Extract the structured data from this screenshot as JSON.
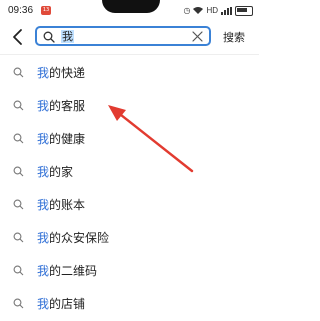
{
  "status_bar": {
    "time": "09:36",
    "app_badge": "13",
    "network": "HD",
    "battery_icon": "battery-icon",
    "wifi_icon": "wifi-icon",
    "signal_icon": "signal-icon"
  },
  "search": {
    "query": "我",
    "action_label": "搜索",
    "accent_color": "#3b82d6"
  },
  "suggestions": [
    {
      "highlight": "我",
      "rest": "的快递"
    },
    {
      "highlight": "我",
      "rest": "的客服"
    },
    {
      "highlight": "我",
      "rest": "的健康"
    },
    {
      "highlight": "我",
      "rest": "的家"
    },
    {
      "highlight": "我",
      "rest": "的账本"
    },
    {
      "highlight": "我",
      "rest": "的众安保险"
    },
    {
      "highlight": "我",
      "rest": "的二维码"
    },
    {
      "highlight": "我",
      "rest": "的店铺"
    }
  ],
  "annotation": {
    "arrow_color": "#e23b30"
  }
}
